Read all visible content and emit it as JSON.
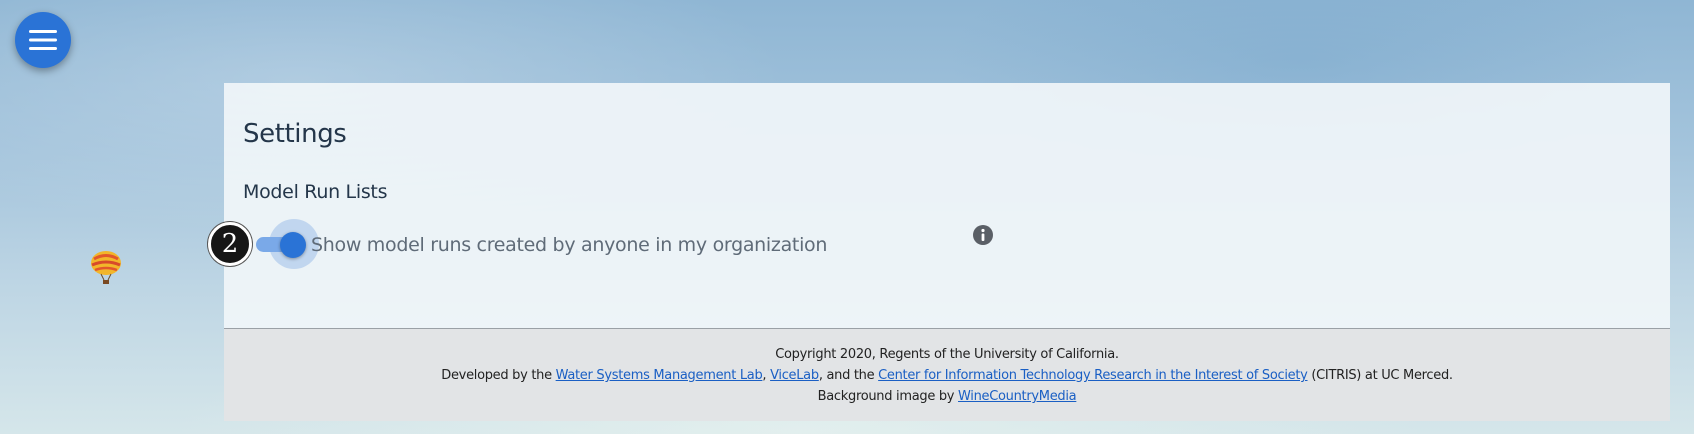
{
  "nav": {
    "menu_icon": "hamburger-menu-icon",
    "menu_button_color": "#2a73d6"
  },
  "background": {
    "decoration_icon": "hot-air-balloon-icon"
  },
  "settings": {
    "title": "Settings",
    "section_title": "Model Run Lists",
    "step_badge": "2",
    "toggle": {
      "label": "Show model runs created by anyone in my organization",
      "checked": true,
      "accent_color": "#2a73d6"
    },
    "info_icon": "info-icon"
  },
  "footer": {
    "copyright": "Copyright 2020, Regents of the University of California.",
    "developed_prefix": "Developed by the ",
    "link_wsml": "Water Systems Management Lab",
    "sep1": ", ",
    "link_vicelab": "ViceLab",
    "sep2": ", and the ",
    "link_citris": "Center for Information Technology Research in the Interest of Society",
    "developed_suffix": " (CITRIS) at UC Merced.",
    "background_prefix": "Background image by ",
    "link_winecountry": "WineCountryMedia",
    "link_color": "#1a5fc4"
  }
}
